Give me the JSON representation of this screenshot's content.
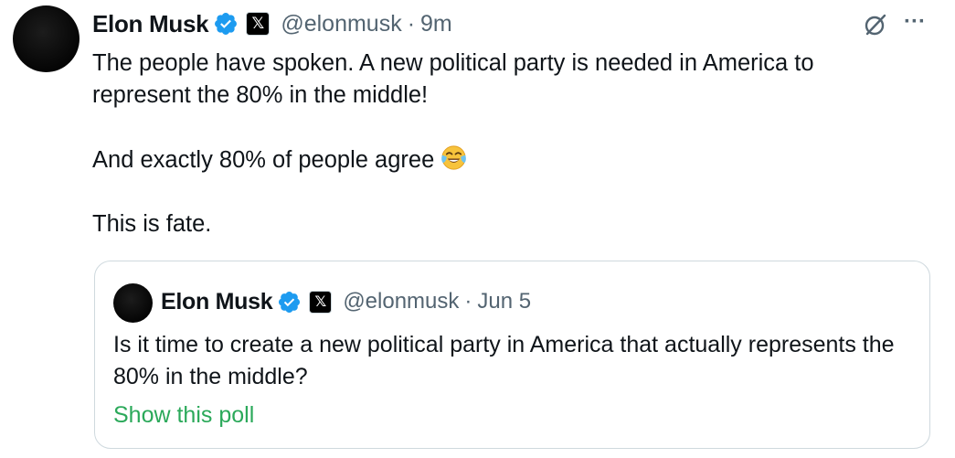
{
  "tweet": {
    "author_name": "Elon Musk",
    "handle": "@elonmusk",
    "separator": "·",
    "time": "9m",
    "text_lines": [
      "The people have spoken. A new political party is needed in America to represent the 80% in the middle!",
      "And exactly 80% of people agree",
      "This is fate."
    ],
    "emoji": "face-with-tears-of-joy"
  },
  "quoted_tweet": {
    "author_name": "Elon Musk",
    "handle": "@elonmusk",
    "separator": "·",
    "time": "Jun 5",
    "text": "Is it time to create a new political party in America that actually represents the 80% in the middle?",
    "poll_link": "Show this poll"
  },
  "icons": {
    "verified": "verified-badge-icon",
    "affiliate": "x-logo-icon",
    "grok": "grok-icon",
    "more": "more-icon"
  },
  "colors": {
    "verified_blue": "#1d9bf0",
    "link_green": "#2ba95a",
    "secondary_text": "#536471",
    "border": "#cfd9de"
  }
}
